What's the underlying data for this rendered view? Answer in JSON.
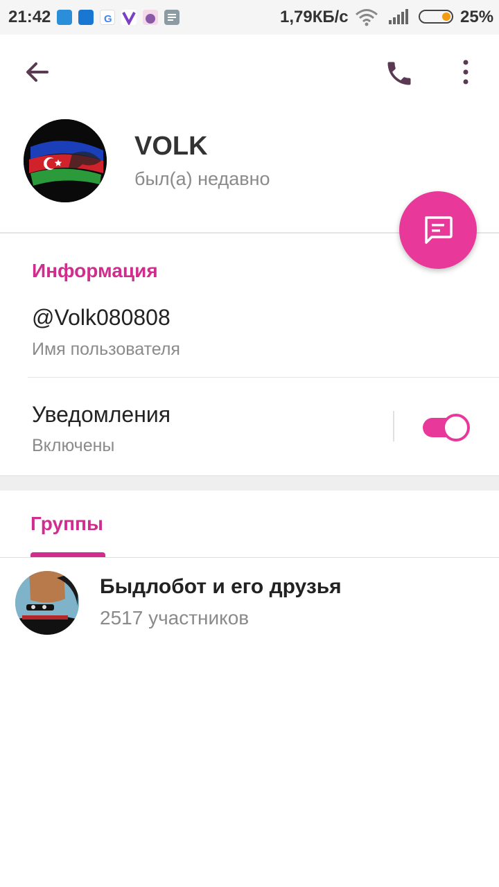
{
  "status_bar": {
    "time": "21:42",
    "net_speed": "1,79КБ/с",
    "battery_percent": "25%",
    "battery_level": 0.25,
    "notification_icons": [
      "app-icon-blue",
      "files-icon",
      "google-icon",
      "viber-icon",
      "cat-app-icon",
      "message-icon"
    ]
  },
  "profile": {
    "name": "VOLK",
    "status": "был(а) недавно"
  },
  "info": {
    "section_title": "Информация",
    "username": "@Volk080808",
    "username_label": "Имя пользователя",
    "notifications_title": "Уведомления",
    "notifications_state": "Включены",
    "notifications_enabled": true
  },
  "groups": {
    "tab_label": "Группы",
    "items": [
      {
        "name": "Быдлобот и его друзья",
        "members": "2517 участников"
      }
    ]
  },
  "colors": {
    "accent": "#d12d8e",
    "fab": "#e8399a",
    "icon": "#5a3a52"
  }
}
